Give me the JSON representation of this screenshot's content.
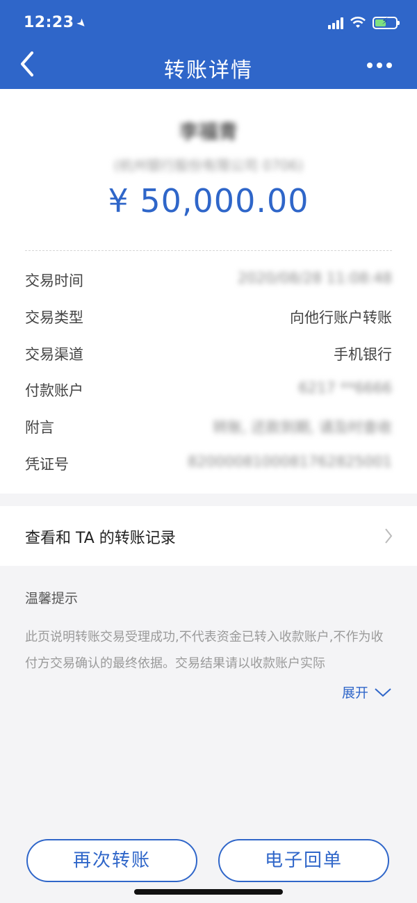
{
  "status_bar": {
    "time": "12:23"
  },
  "nav": {
    "title": "转账详情"
  },
  "transfer": {
    "payee_name": "李福青",
    "payee_bank": "(杭州银行股份有限公司 0706)",
    "amount": "¥ 50,000.00"
  },
  "details": [
    {
      "label": "交易时间",
      "value": "2020/08/28 11:08:48",
      "obscured": true
    },
    {
      "label": "交易类型",
      "value": "向他行账户转账",
      "obscured": false
    },
    {
      "label": "交易渠道",
      "value": "手机银行",
      "obscured": false
    },
    {
      "label": "付款账户",
      "value": "6217 **6666",
      "obscured": true
    },
    {
      "label": "附言",
      "value": "转账, 还款到期, 请及时查收",
      "obscured": true
    },
    {
      "label": "凭证号",
      "value": "8200008100081762825001",
      "obscured": true
    }
  ],
  "records_link": {
    "label": "查看和 TA 的转账记录"
  },
  "tips": {
    "title": "温馨提示",
    "body": "此页说明转账交易受理成功,不代表资金已转入收款账户,不作为收付方交易确认的最终依据。交易结果请以收款账户实际",
    "expand_label": "展开"
  },
  "buttons": {
    "again": "再次转账",
    "receipt": "电子回单"
  },
  "colors": {
    "primary": "#2f66c9",
    "background": "#f4f4f6"
  }
}
